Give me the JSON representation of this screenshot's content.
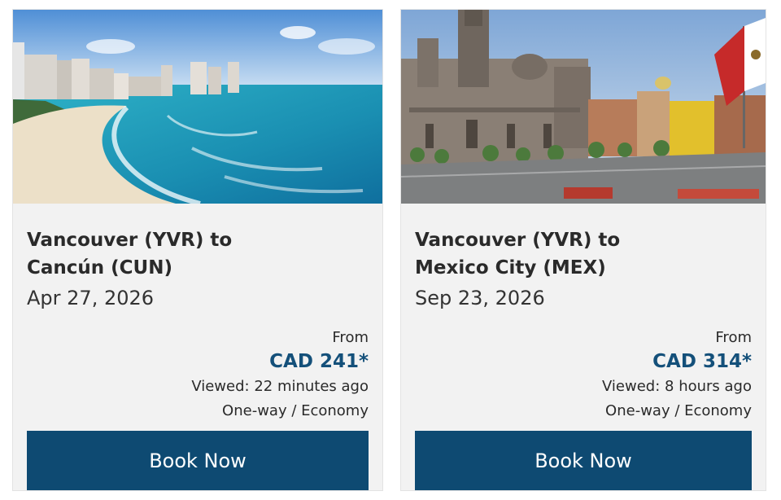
{
  "cards": [
    {
      "route_line1": "Vancouver (YVR) to",
      "route_line2": "Cancún (CUN)",
      "date": "Apr 27, 2026",
      "from_label": "From",
      "price": "CAD 241*",
      "viewed": "Viewed: 22 minutes ago",
      "trip": "One-way / Economy",
      "book_label": "Book Now"
    },
    {
      "route_line1": "Vancouver (YVR) to",
      "route_line2": "Mexico City (MEX)",
      "date": "Sep 23, 2026",
      "from_label": "From",
      "price": "CAD 314*",
      "viewed": "Viewed: 8 hours ago",
      "trip": "One-way / Economy",
      "book_label": "Book Now"
    }
  ],
  "colors": {
    "card_background": "#f2f2f2",
    "price_text": "#14507a",
    "button_background": "#0e4a72",
    "button_text": "#ffffff"
  }
}
